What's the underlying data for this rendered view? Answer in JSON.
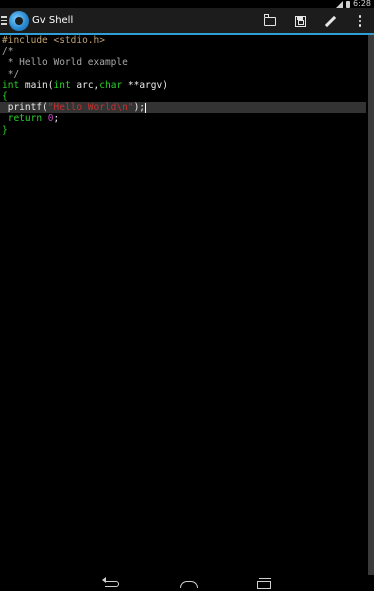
{
  "status_bar": {
    "time": "6:28"
  },
  "app_bar": {
    "menu_icon": "hamburger-icon",
    "logo_icon": "gv-shell-logo-icon",
    "title": "Gv Shell",
    "actions": [
      {
        "name": "open-file-button",
        "icon": "folder-open-icon"
      },
      {
        "name": "save-file-button",
        "icon": "save-icon"
      },
      {
        "name": "edit-button",
        "icon": "pencil-icon"
      },
      {
        "name": "overflow-menu-button",
        "icon": "more-vert-icon"
      }
    ]
  },
  "editor": {
    "lines": [
      [
        {
          "t": "#include <stdio.h>",
          "c": "pp"
        }
      ],
      [
        {
          "t": "/*",
          "c": "cm"
        }
      ],
      [
        {
          "t": " * Hello World example",
          "c": "cm"
        }
      ],
      [
        {
          "t": " */",
          "c": "cm"
        }
      ],
      [
        {
          "t": "int",
          "c": "kw"
        },
        {
          "t": " main(",
          "c": "df"
        },
        {
          "t": "int",
          "c": "kw"
        },
        {
          "t": " arc,",
          "c": "df"
        },
        {
          "t": "char",
          "c": "kw"
        },
        {
          "t": " **argv)",
          "c": "df"
        }
      ],
      [
        {
          "t": "{",
          "c": "kw"
        }
      ],
      [
        {
          "t": " printf(",
          "c": "df"
        },
        {
          "t": "\"Hello World\\n\"",
          "c": "str"
        },
        {
          "t": ");",
          "c": "df"
        }
      ],
      [
        {
          "t": " return",
          "c": "kw"
        },
        {
          "t": " 0",
          "c": "num"
        },
        {
          "t": ";",
          "c": "df"
        }
      ],
      [
        {
          "t": "}",
          "c": "kw"
        }
      ]
    ],
    "active_line": 6
  },
  "nav_bar": {
    "buttons": [
      {
        "name": "back-button",
        "icon": "back-icon"
      },
      {
        "name": "home-button",
        "icon": "home-icon"
      },
      {
        "name": "recents-button",
        "icon": "recents-icon"
      }
    ]
  },
  "colors": {
    "accent": "#2f9fd6",
    "preprocessor": "#c0a070",
    "comment": "#a8a8a8",
    "keyword": "#28d228",
    "string": "#c43030",
    "number": "#c050c0",
    "background": "#000000"
  }
}
